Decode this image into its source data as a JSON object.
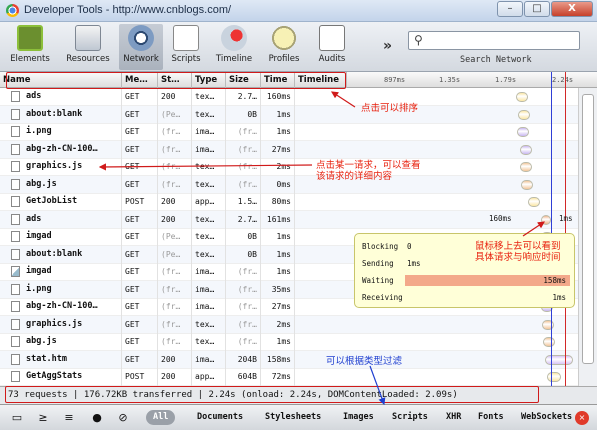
{
  "window": {
    "title": "Developer Tools - http://www.cnblogs.com/",
    "minimize": "–",
    "maximize": "□",
    "close": "X"
  },
  "toolbar": {
    "tools": [
      {
        "label": "Elements",
        "icon": "elements-icon"
      },
      {
        "label": "Resources",
        "icon": "resources-icon"
      },
      {
        "label": "Network",
        "icon": "network-icon"
      },
      {
        "label": "Scripts",
        "icon": "scripts-icon"
      },
      {
        "label": "Timeline",
        "icon": "timeline-icon"
      },
      {
        "label": "Profiles",
        "icon": "profiles-icon"
      },
      {
        "label": "Audits",
        "icon": "audits-icon"
      }
    ],
    "more": "»",
    "search_placeholder": "",
    "search_label": "Search Network"
  },
  "columns": {
    "name": "Name",
    "method": "Me…",
    "status": "St…",
    "type": "Type",
    "size": "Size",
    "time": "Time",
    "timeline": "Timeline",
    "ticks": [
      "897ms",
      "1.35s",
      "1.79s",
      "2.24s"
    ]
  },
  "rows": [
    {
      "name": "ads",
      "method": "GET",
      "status": "200",
      "type": "tex…",
      "size": "2.7…",
      "time": "160ms",
      "icon": "file",
      "dim_status": false,
      "dim_size": false
    },
    {
      "name": "about:blank",
      "method": "GET",
      "status": "(Pe…",
      "type": "tex…",
      "size": "0B",
      "time": "1ms",
      "icon": "file",
      "dim_status": true,
      "dim_size": false
    },
    {
      "name": "i.png",
      "method": "GET",
      "status": "(fr…",
      "type": "ima…",
      "size": "(fr…",
      "time": "1ms",
      "icon": "file",
      "dim_status": true,
      "dim_size": true
    },
    {
      "name": "abg-zh-CN-100…",
      "method": "GET",
      "status": "(fr…",
      "type": "ima…",
      "size": "(fr…",
      "time": "27ms",
      "icon": "file",
      "dim_status": true,
      "dim_size": true
    },
    {
      "name": "graphics.js",
      "method": "GET",
      "status": "(fr…",
      "type": "tex…",
      "size": "(fr…",
      "time": "2ms",
      "icon": "file",
      "dim_status": true,
      "dim_size": true
    },
    {
      "name": "abg.js",
      "method": "GET",
      "status": "(fr…",
      "type": "tex…",
      "size": "(fr…",
      "time": "0ms",
      "icon": "file",
      "dim_status": true,
      "dim_size": true
    },
    {
      "name": "GetJobList",
      "method": "POST",
      "status": "200",
      "type": "app…",
      "size": "1.5…",
      "time": "80ms",
      "icon": "file",
      "dim_status": false,
      "dim_size": false
    },
    {
      "name": "ads",
      "method": "GET",
      "status": "200",
      "type": "tex…",
      "size": "2.7…",
      "time": "161ms",
      "icon": "file",
      "dim_status": false,
      "dim_size": false
    },
    {
      "name": "imgad",
      "method": "GET",
      "status": "(Pe…",
      "type": "tex…",
      "size": "0B",
      "time": "1ms",
      "icon": "file",
      "dim_status": true,
      "dim_size": false
    },
    {
      "name": "about:blank",
      "method": "GET",
      "status": "(Pe…",
      "type": "tex…",
      "size": "0B",
      "time": "1ms",
      "icon": "file",
      "dim_status": true,
      "dim_size": false
    },
    {
      "name": "imgad",
      "method": "GET",
      "status": "(fr…",
      "type": "ima…",
      "size": "(fr…",
      "time": "1ms",
      "icon": "img",
      "dim_status": true,
      "dim_size": true
    },
    {
      "name": "i.png",
      "method": "GET",
      "status": "(fr…",
      "type": "ima…",
      "size": "(fr…",
      "time": "35ms",
      "icon": "file",
      "dim_status": true,
      "dim_size": true
    },
    {
      "name": "abg-zh-CN-100…",
      "method": "GET",
      "status": "(fr…",
      "type": "ima…",
      "size": "(fr…",
      "time": "27ms",
      "icon": "file",
      "dim_status": true,
      "dim_size": true
    },
    {
      "name": "graphics.js",
      "method": "GET",
      "status": "(fr…",
      "type": "tex…",
      "size": "(fr…",
      "time": "2ms",
      "icon": "file",
      "dim_status": true,
      "dim_size": true
    },
    {
      "name": "abg.js",
      "method": "GET",
      "status": "(fr…",
      "type": "tex…",
      "size": "(fr…",
      "time": "1ms",
      "icon": "file",
      "dim_status": true,
      "dim_size": true
    },
    {
      "name": "stat.htm",
      "method": "GET",
      "status": "200",
      "type": "ima…",
      "size": "204B",
      "time": "158ms",
      "icon": "file",
      "dim_status": false,
      "dim_size": false
    },
    {
      "name": "GetAggStats",
      "method": "POST",
      "status": "200",
      "type": "app…",
      "size": "604B",
      "time": "72ms",
      "icon": "file",
      "dim_status": false,
      "dim_size": false
    }
  ],
  "timeline_labels": {
    "left": "160ms",
    "right": "1ms"
  },
  "popup": {
    "blocking_label": "Blocking",
    "blocking_value": "0",
    "sending_label": "Sending",
    "sending_value": "1ms",
    "waiting_label": "Waiting",
    "waiting_value": "158ms",
    "receiving_label": "Receiving",
    "receiving_value": "1ms"
  },
  "summary": "73 requests  |  176.72KB transferred  |  2.24s (onload: 2.24s, DOMContentLoaded: 2.09s)",
  "bottombar": {
    "filters": [
      "All",
      "Documents",
      "Stylesheets",
      "Images",
      "Scripts",
      "XHR",
      "Fonts",
      "WebSockets"
    ]
  },
  "annotations": {
    "sort": "点击可以排序",
    "detail": "点击某一请求，可以查看\n该请求的详细内容",
    "hover": "鼠标移上去可以看到\n具体请求与响应时间",
    "filter": "可以根据类型过滤"
  },
  "colors": {
    "accent_red": "#e8220f",
    "annotation_blue": "#1f3fd0",
    "domcontent_line": "#2f3fd6",
    "onload_line": "#d22828"
  }
}
